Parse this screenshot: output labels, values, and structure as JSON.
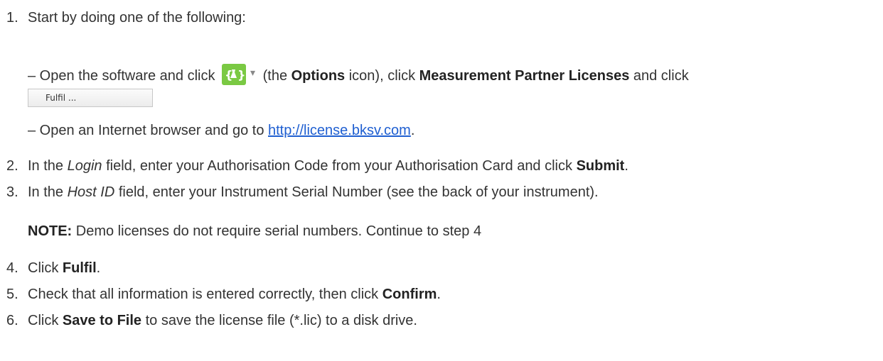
{
  "steps": [
    {
      "num": "1.",
      "text": "Start by doing one of the following:"
    },
    {
      "num": "2.",
      "pre": "In the ",
      "italic": "Login",
      "mid": " field, enter your Authorisation Code from your Authorisation Card and click ",
      "bold": "Submit",
      "post": "."
    },
    {
      "num": "3.",
      "pre": "In the ",
      "italic": "Host ID",
      "mid": " field, enter your Instrument Serial Number (see the back of your instrument).",
      "bold": "",
      "post": ""
    },
    {
      "num": "4.",
      "pre": "Click ",
      "bold": "Fulfil",
      "post": "."
    },
    {
      "num": "5.",
      "pre": "Check that all information is entered correctly, then click ",
      "bold": "Confirm",
      "post": "."
    },
    {
      "num": "6.",
      "pre": "Click ",
      "bold": "Save to File",
      "post": " to save the license file (*.lic) to a disk drive."
    }
  ],
  "option_a": {
    "pre": "– Open the software and click ",
    "icon": "options-icon",
    "paren_open": " (the ",
    "options_label": "Options",
    "paren_close": " icon), click ",
    "licenses_label": "Measurement Partner Licenses",
    "post": " and click",
    "button_label": "Fulfil ..."
  },
  "option_b": {
    "pre": "– Open an Internet browser and go to ",
    "link": "http://license.bksv.com",
    "post": "."
  },
  "note": {
    "label": "NOTE:",
    "text": " Demo licenses do not require serial numbers. Continue to step 4"
  },
  "colors": {
    "text": "#333333",
    "link": "#1f5fd1",
    "icon_bg": "#7ac943"
  }
}
